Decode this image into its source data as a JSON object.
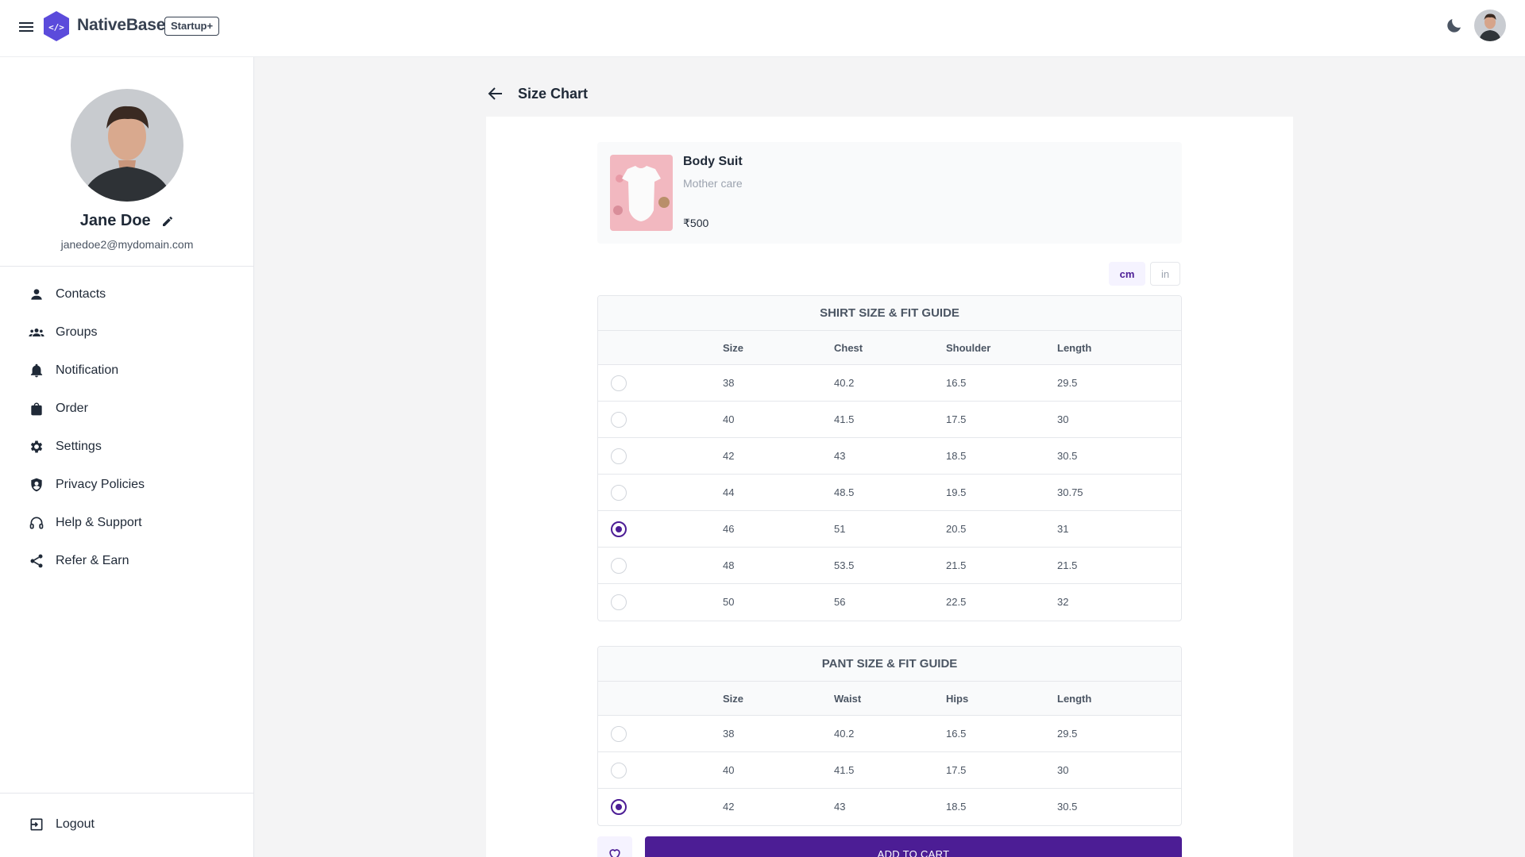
{
  "header": {
    "brand": "NativeBase",
    "badge": "Startup+",
    "logo_text": "</>"
  },
  "sidebar": {
    "profile": {
      "name": "Jane Doe",
      "email": "janedoe2@mydomain.com"
    },
    "items": [
      {
        "label": "Contacts",
        "icon": "person-icon"
      },
      {
        "label": "Groups",
        "icon": "groups-icon"
      },
      {
        "label": "Notification",
        "icon": "bell-icon"
      },
      {
        "label": "Order",
        "icon": "bag-icon"
      },
      {
        "label": "Settings",
        "icon": "gear-icon"
      },
      {
        "label": "Privacy Policies",
        "icon": "shield-icon"
      },
      {
        "label": "Help & Support",
        "icon": "headset-icon"
      },
      {
        "label": "Refer & Earn",
        "icon": "share-icon"
      }
    ],
    "logout": "Logout"
  },
  "main": {
    "title": "Size Chart",
    "product": {
      "name": "Body Suit",
      "brand": "Mother care",
      "price": "₹500"
    },
    "units": [
      {
        "label": "cm",
        "active": true
      },
      {
        "label": "in",
        "active": false
      }
    ],
    "shirt_guide": {
      "title": "SHIRT SIZE & FIT GUIDE",
      "columns": [
        "Size",
        "Chest",
        "Shoulder",
        "Length"
      ],
      "rows": [
        [
          "38",
          "40.2",
          "16.5",
          "29.5"
        ],
        [
          "40",
          "41.5",
          "17.5",
          "30"
        ],
        [
          "42",
          "43",
          "18.5",
          "30.5"
        ],
        [
          "44",
          "48.5",
          "19.5",
          "30.75"
        ],
        [
          "46",
          "51",
          "20.5",
          "31"
        ],
        [
          "48",
          "53.5",
          "21.5",
          "21.5"
        ],
        [
          "50",
          "56",
          "22.5",
          "32"
        ]
      ],
      "selected_index": 4
    },
    "pant_guide": {
      "title": "PANT SIZE & FIT GUIDE",
      "columns": [
        "Size",
        "Waist",
        "Hips",
        "Length"
      ],
      "rows": [
        [
          "38",
          "40.2",
          "16.5",
          "29.5"
        ],
        [
          "40",
          "41.5",
          "17.5",
          "30"
        ],
        [
          "42",
          "43",
          "18.5",
          "30.5"
        ]
      ],
      "selected_index": 2
    },
    "add_to_cart": "ADD TO CART"
  },
  "colors": {
    "primary": "#4c1d95",
    "logo": "#6d28d9",
    "background": "#f4f4f5"
  }
}
